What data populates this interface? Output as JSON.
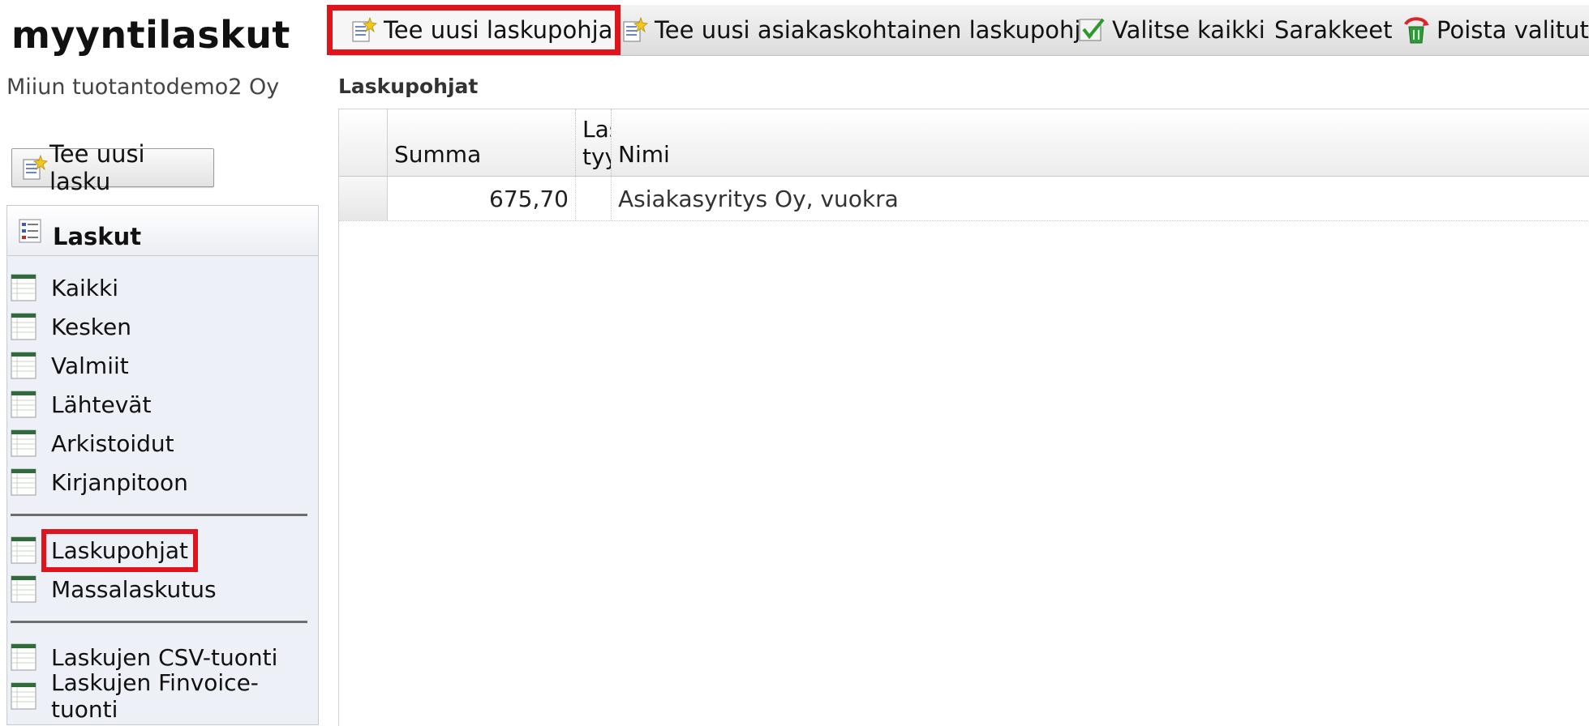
{
  "app": {
    "title": "myyntilaskut",
    "company": "Miiun tuotantodemo2 Oy"
  },
  "sidebar": {
    "new_invoice_label": "Tee uusi lasku",
    "panel_title": "Laskut",
    "groups": [
      [
        "Kaikki",
        "Kesken",
        "Valmiit",
        "Lähtevät",
        "Arkistoidut",
        "Kirjanpitoon"
      ],
      [
        "Laskupohjat",
        "Massalaskutus"
      ],
      [
        "Laskujen CSV-tuonti",
        "Laskujen Finvoice-tuonti"
      ]
    ],
    "selected": "Laskupohjat"
  },
  "toolbar": {
    "new_template": "Tee uusi laskupohja",
    "new_customer_template": "Tee uusi asiakaskohtainen laskupohja",
    "select_all": "Valitse kaikki",
    "columns": "Sarakkeet",
    "delete_selected": "Poista valitut"
  },
  "content": {
    "section_title": "Laskupohjat",
    "columns": {
      "sum": "Summa",
      "type_line1": "Las",
      "type_line2": "tyy",
      "name": "Nimi"
    },
    "rows": [
      {
        "sum": "675,70",
        "type": "",
        "name": "Asiakasyritys Oy, vuokra"
      }
    ]
  },
  "colors": {
    "highlight": "#e0141c",
    "panel_bg": "#eef0f7"
  }
}
